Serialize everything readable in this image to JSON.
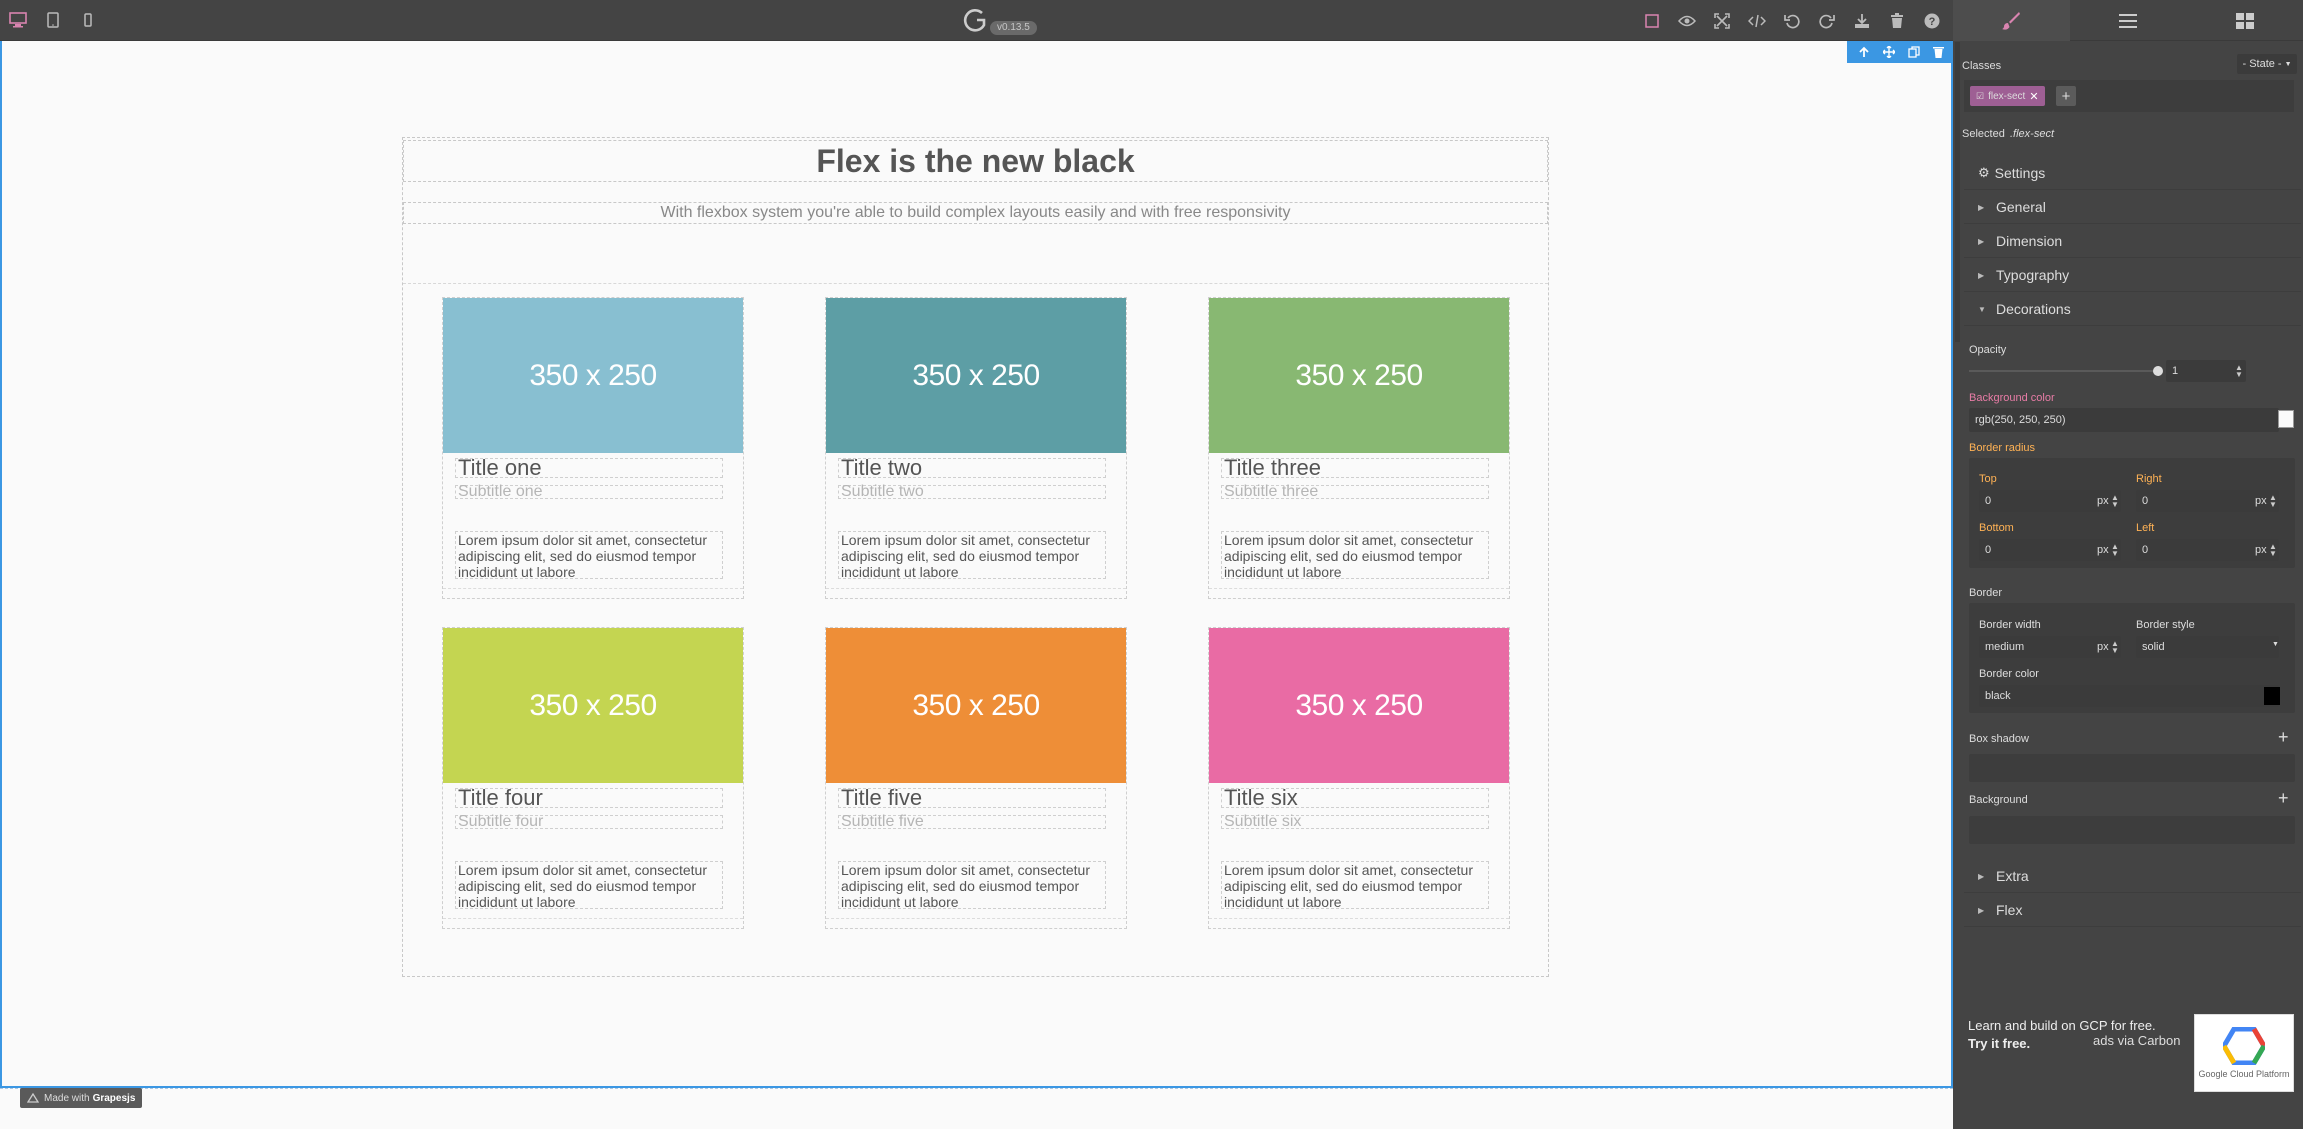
{
  "app": {
    "version": "v0.13.5"
  },
  "topbar": {
    "devices": [
      "desktop-icon",
      "tablet-icon",
      "mobile-icon"
    ],
    "actions": [
      "sw-visibility-icon",
      "preview-icon",
      "fullscreen-icon",
      "code-icon",
      "undo-icon",
      "redo-icon",
      "import-icon",
      "clear-canvas-icon",
      "help-icon"
    ]
  },
  "canvas": {
    "heading": "Flex is the new black",
    "subheading": "With flexbox system you're able to build complex layouts easily and with free responsivity",
    "cards": [
      {
        "image": "350 x 250",
        "color": "#88bfd1",
        "title": "Title one",
        "subtitle": "Subtitle one",
        "text": "Lorem ipsum dolor sit amet, consectetur adipiscing elit, sed do eiusmod tempor incididunt ut labore"
      },
      {
        "image": "350 x 250",
        "color": "#5d9ea5",
        "title": "Title two",
        "subtitle": "Subtitle two",
        "text": "Lorem ipsum dolor sit amet, consectetur adipiscing elit, sed do eiusmod tempor incididunt ut labore"
      },
      {
        "image": "350 x 250",
        "color": "#88b872",
        "title": "Title three",
        "subtitle": "Subtitle three",
        "text": "Lorem ipsum dolor sit amet, consectetur adipiscing elit, sed do eiusmod tempor incididunt ut labore"
      },
      {
        "image": "350 x 250",
        "color": "#c4d551",
        "title": "Title four",
        "subtitle": "Subtitle four",
        "text": "Lorem ipsum dolor sit amet, consectetur adipiscing elit, sed do eiusmod tempor incididunt ut labore"
      },
      {
        "image": "350 x 250",
        "color": "#ee8e37",
        "title": "Title five",
        "subtitle": "Subtitle five",
        "text": "Lorem ipsum dolor sit amet, consectetur adipiscing elit, sed do eiusmod tempor incididunt ut labore"
      },
      {
        "image": "350 x 250",
        "color": "#e96ba4",
        "title": "Title six",
        "subtitle": "Subtitle six",
        "text": "Lorem ipsum dolor sit amet, consectetur adipiscing elit, sed do eiusmod tempor incididunt ut labore"
      }
    ],
    "made_with": "Made with",
    "made_with_brand": "Grapesjs"
  },
  "panel": {
    "tabs": [
      "style-manager-icon",
      "layer-manager-icon",
      "blocks-icon"
    ],
    "classes_label": "Classes",
    "state_label": "- State -",
    "class_tag": "flex-sect",
    "selected_label": "Selected",
    "selected_value": ".flex-sect",
    "settings_label": "Settings",
    "sectors": {
      "general": "General",
      "dimension": "Dimension",
      "typography": "Typography",
      "decorations": "Decorations",
      "extra": "Extra",
      "flex": "Flex"
    },
    "decorations": {
      "opacity_label": "Opacity",
      "opacity_value": "1",
      "bg_color_label": "Background color",
      "bg_color_value": "rgb(250, 250, 250)",
      "border_radius_label": "Border radius",
      "top_label": "Top",
      "top_value": "0",
      "right_label": "Right",
      "right_value": "0",
      "bottom_label": "Bottom",
      "bottom_value": "0",
      "left_label": "Left",
      "left_value": "0",
      "unit": "px",
      "border_label": "Border",
      "border_width_label": "Border width",
      "border_width_value": "medium",
      "border_style_label": "Border style",
      "border_style_value": "solid",
      "border_color_label": "Border color",
      "border_color_value": "black",
      "box_shadow_label": "Box shadow",
      "background_label": "Background"
    },
    "ad": {
      "line1": "Learn and build on GCP for free.",
      "line2": "Try it free.",
      "via": "ads via Carbon",
      "logo_text": "Google Cloud Platform"
    }
  }
}
